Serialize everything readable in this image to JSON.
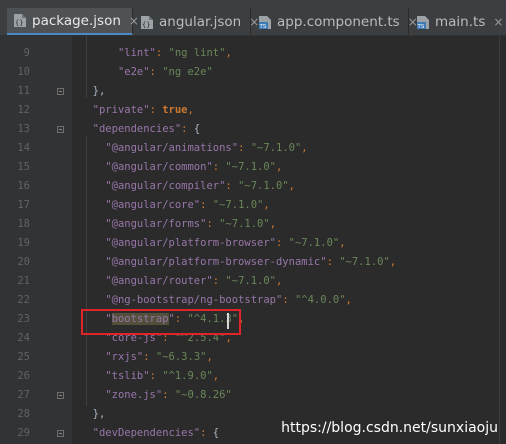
{
  "tabs": [
    {
      "label": "package.json",
      "icon": "json-file-icon",
      "active": true
    },
    {
      "label": "angular.json",
      "icon": "json-file-icon",
      "active": false
    },
    {
      "label": "app.component.ts",
      "icon": "typescript-file-icon",
      "active": false
    },
    {
      "label": "main.ts",
      "icon": "typescript-file-icon",
      "active": false
    }
  ],
  "close_glyph": "×",
  "line_numbers": [
    "9",
    "10",
    "11",
    "12",
    "13",
    "14",
    "15",
    "16",
    "17",
    "18",
    "19",
    "20",
    "21",
    "22",
    "23",
    "24",
    "25",
    "26",
    "27",
    "28",
    "29"
  ],
  "code": {
    "l9_key": "\"lint\"",
    "l9_val": "\"ng lint\"",
    "l10_key": "\"e2e\"",
    "l10_val": "\"ng e2e\"",
    "l11": "},",
    "l12_key": "\"private\"",
    "l12_val": "true",
    "l13_key": "\"dependencies\"",
    "l13_rest": "{",
    "l14_key": "\"@angular/animations\"",
    "l14_val": "\"~7.1.0\"",
    "l15_key": "\"@angular/common\"",
    "l15_val": "\"~7.1.0\"",
    "l16_key": "\"@angular/compiler\"",
    "l16_val": "\"~7.1.0\"",
    "l17_key": "\"@angular/core\"",
    "l17_val": "\"~7.1.0\"",
    "l18_key": "\"@angular/forms\"",
    "l18_val": "\"~7.1.0\"",
    "l19_key": "\"@angular/platform-browser\"",
    "l19_val": "\"~7.1.0\"",
    "l20_key": "\"@angular/platform-browser-dynamic\"",
    "l20_val": "\"~7.1.0\"",
    "l21_key": "\"@angular/router\"",
    "l21_val": "\"~7.1.0\"",
    "l22_key": "\"@ng-bootstrap/ng-bootstrap\"",
    "l22_val": "\"^4.0.0\"",
    "l23_q1": "\"",
    "l23_word": "bootstrap",
    "l23_q2": "\"",
    "l23_val": "\"^4.1.3\"",
    "l24_key": "\"core-js\"",
    "l24_val": "\"^2.5.4\"",
    "l25_key": "\"rxjs\"",
    "l25_val": "\"~6.3.3\"",
    "l26_key": "\"tslib\"",
    "l26_val": "\"^1.9.0\"",
    "l27_key": "\"zone.js\"",
    "l27_val": "\"~0.8.26\"",
    "l28": "},",
    "l29_key": "\"devDependencies\"",
    "l29_rest": "{"
  },
  "colors": {
    "key": "#9876aa",
    "string": "#6a8759",
    "punctuation": "#cc7832",
    "highlight_box": "#e0242a",
    "active_tab_underline": "#4a88c7"
  },
  "watermark": "https://blog.csdn.net/sunxiaoju"
}
